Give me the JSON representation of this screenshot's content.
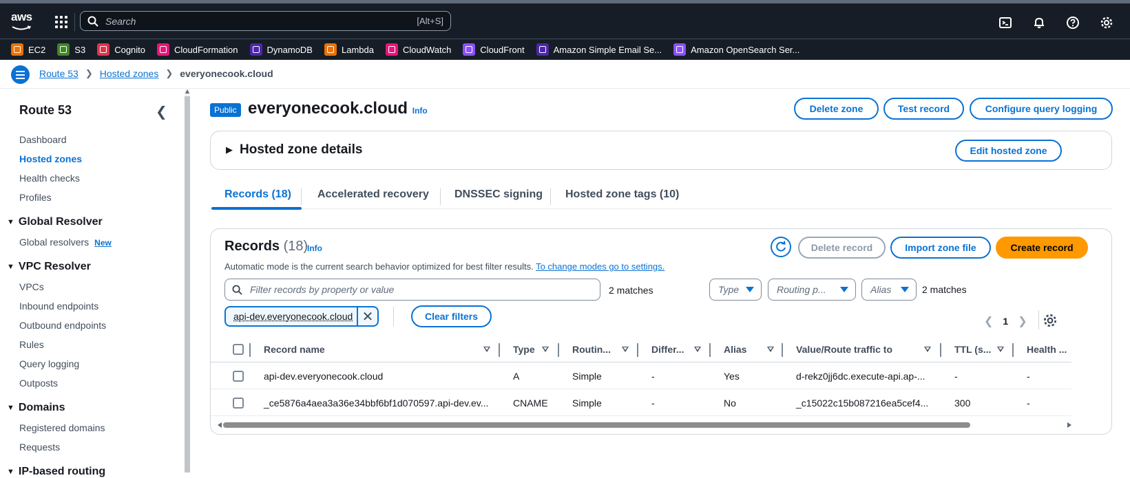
{
  "header": {
    "logo_text": "aws",
    "search_placeholder": "Search",
    "search_shortcut": "[Alt+S]",
    "icons": [
      "cloudshell-icon",
      "bell-icon",
      "help-icon",
      "settings-icon"
    ]
  },
  "favorites": [
    {
      "label": "EC2",
      "color": "#ed7100"
    },
    {
      "label": "S3",
      "color": "#3f8624"
    },
    {
      "label": "Cognito",
      "color": "#dd344c"
    },
    {
      "label": "CloudFormation",
      "color": "#e7157b"
    },
    {
      "label": "DynamoDB",
      "color": "#4d27aa"
    },
    {
      "label": "Lambda",
      "color": "#ed7100"
    },
    {
      "label": "CloudWatch",
      "color": "#e7157b"
    },
    {
      "label": "CloudFront",
      "color": "#8c4fff"
    },
    {
      "label": "Amazon Simple Email Se...",
      "color": "#4d27aa"
    },
    {
      "label": "Amazon OpenSearch Ser...",
      "color": "#8c4fff"
    }
  ],
  "breadcrumb": {
    "items": [
      "Route 53",
      "Hosted zones"
    ],
    "current": "everyonecook.cloud"
  },
  "sidenav": {
    "title": "Route 53",
    "items": [
      "Dashboard",
      "Hosted zones",
      "Health checks",
      "Profiles"
    ],
    "sections": [
      {
        "title": "Global Resolver",
        "items": [
          "Global resolvers"
        ],
        "badge": "New"
      },
      {
        "title": "VPC Resolver",
        "items": [
          "VPCs",
          "Inbound endpoints",
          "Outbound endpoints",
          "Rules",
          "Query logging",
          "Outposts"
        ]
      },
      {
        "title": "Domains",
        "items": [
          "Registered domains",
          "Requests"
        ]
      },
      {
        "title": "IP-based routing"
      }
    ]
  },
  "page": {
    "badge": "Public",
    "title": "everyonecook.cloud",
    "info": "Info",
    "buttons": {
      "delete_zone": "Delete zone",
      "test_record": "Test record",
      "configure_logging": "Configure query logging"
    },
    "details_title": "Hosted zone details",
    "edit_zone": "Edit hosted zone",
    "tabs": [
      "Records (18)",
      "Accelerated recovery",
      "DNSSEC signing",
      "Hosted zone tags (10)"
    ]
  },
  "records": {
    "title": "Records",
    "count": "(18)",
    "info": "Info",
    "delete_record": "Delete record",
    "import_zone": "Import zone file",
    "create_record": "Create record",
    "description": "Automatic mode is the current search behavior optimized for best filter results.",
    "settings_link": "To change modes go to settings.",
    "filter_placeholder": "Filter records by property or value",
    "matches_left": "2 matches",
    "matches_right": "2 matches",
    "type_select": "Type",
    "routing_select": "Routing p...",
    "alias_select": "Alias",
    "token": "api-dev.everyonecook.cloud",
    "clear_filters": "Clear filters",
    "page_num": "1",
    "columns": [
      "Record name",
      "Type",
      "Routin...",
      "Differ...",
      "Alias",
      "Value/Route traffic to",
      "TTL (s...",
      "Health ..."
    ],
    "rows": [
      [
        "api-dev.everyonecook.cloud",
        "A",
        "Simple",
        "-",
        "Yes",
        "d-rekz0jj6dc.execute-api.ap-...",
        "-",
        "-"
      ],
      [
        "_ce5876a4aea3a36e34bbf6bf1d070597.api-dev.ev...",
        "CNAME",
        "Simple",
        "-",
        "No",
        "_c15022c15b087216ea5cef4...",
        "300",
        "-"
      ]
    ]
  }
}
